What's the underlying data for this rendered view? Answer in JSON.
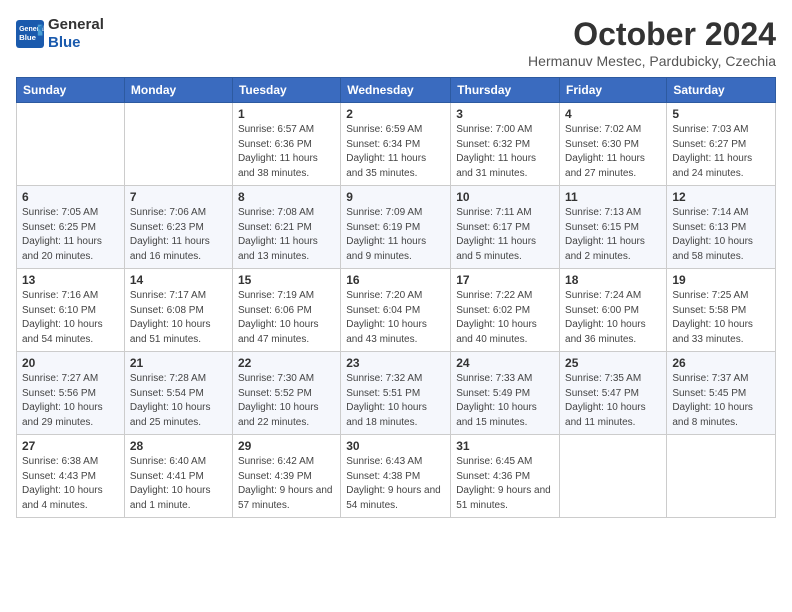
{
  "header": {
    "logo_line1": "General",
    "logo_line2": "Blue",
    "month": "October 2024",
    "location": "Hermanuv Mestec, Pardubicky, Czechia"
  },
  "weekdays": [
    "Sunday",
    "Monday",
    "Tuesday",
    "Wednesday",
    "Thursday",
    "Friday",
    "Saturday"
  ],
  "weeks": [
    [
      {
        "day": "",
        "info": ""
      },
      {
        "day": "",
        "info": ""
      },
      {
        "day": "1",
        "info": "Sunrise: 6:57 AM\nSunset: 6:36 PM\nDaylight: 11 hours and 38 minutes."
      },
      {
        "day": "2",
        "info": "Sunrise: 6:59 AM\nSunset: 6:34 PM\nDaylight: 11 hours and 35 minutes."
      },
      {
        "day": "3",
        "info": "Sunrise: 7:00 AM\nSunset: 6:32 PM\nDaylight: 11 hours and 31 minutes."
      },
      {
        "day": "4",
        "info": "Sunrise: 7:02 AM\nSunset: 6:30 PM\nDaylight: 11 hours and 27 minutes."
      },
      {
        "day": "5",
        "info": "Sunrise: 7:03 AM\nSunset: 6:27 PM\nDaylight: 11 hours and 24 minutes."
      }
    ],
    [
      {
        "day": "6",
        "info": "Sunrise: 7:05 AM\nSunset: 6:25 PM\nDaylight: 11 hours and 20 minutes."
      },
      {
        "day": "7",
        "info": "Sunrise: 7:06 AM\nSunset: 6:23 PM\nDaylight: 11 hours and 16 minutes."
      },
      {
        "day": "8",
        "info": "Sunrise: 7:08 AM\nSunset: 6:21 PM\nDaylight: 11 hours and 13 minutes."
      },
      {
        "day": "9",
        "info": "Sunrise: 7:09 AM\nSunset: 6:19 PM\nDaylight: 11 hours and 9 minutes."
      },
      {
        "day": "10",
        "info": "Sunrise: 7:11 AM\nSunset: 6:17 PM\nDaylight: 11 hours and 5 minutes."
      },
      {
        "day": "11",
        "info": "Sunrise: 7:13 AM\nSunset: 6:15 PM\nDaylight: 11 hours and 2 minutes."
      },
      {
        "day": "12",
        "info": "Sunrise: 7:14 AM\nSunset: 6:13 PM\nDaylight: 10 hours and 58 minutes."
      }
    ],
    [
      {
        "day": "13",
        "info": "Sunrise: 7:16 AM\nSunset: 6:10 PM\nDaylight: 10 hours and 54 minutes."
      },
      {
        "day": "14",
        "info": "Sunrise: 7:17 AM\nSunset: 6:08 PM\nDaylight: 10 hours and 51 minutes."
      },
      {
        "day": "15",
        "info": "Sunrise: 7:19 AM\nSunset: 6:06 PM\nDaylight: 10 hours and 47 minutes."
      },
      {
        "day": "16",
        "info": "Sunrise: 7:20 AM\nSunset: 6:04 PM\nDaylight: 10 hours and 43 minutes."
      },
      {
        "day": "17",
        "info": "Sunrise: 7:22 AM\nSunset: 6:02 PM\nDaylight: 10 hours and 40 minutes."
      },
      {
        "day": "18",
        "info": "Sunrise: 7:24 AM\nSunset: 6:00 PM\nDaylight: 10 hours and 36 minutes."
      },
      {
        "day": "19",
        "info": "Sunrise: 7:25 AM\nSunset: 5:58 PM\nDaylight: 10 hours and 33 minutes."
      }
    ],
    [
      {
        "day": "20",
        "info": "Sunrise: 7:27 AM\nSunset: 5:56 PM\nDaylight: 10 hours and 29 minutes."
      },
      {
        "day": "21",
        "info": "Sunrise: 7:28 AM\nSunset: 5:54 PM\nDaylight: 10 hours and 25 minutes."
      },
      {
        "day": "22",
        "info": "Sunrise: 7:30 AM\nSunset: 5:52 PM\nDaylight: 10 hours and 22 minutes."
      },
      {
        "day": "23",
        "info": "Sunrise: 7:32 AM\nSunset: 5:51 PM\nDaylight: 10 hours and 18 minutes."
      },
      {
        "day": "24",
        "info": "Sunrise: 7:33 AM\nSunset: 5:49 PM\nDaylight: 10 hours and 15 minutes."
      },
      {
        "day": "25",
        "info": "Sunrise: 7:35 AM\nSunset: 5:47 PM\nDaylight: 10 hours and 11 minutes."
      },
      {
        "day": "26",
        "info": "Sunrise: 7:37 AM\nSunset: 5:45 PM\nDaylight: 10 hours and 8 minutes."
      }
    ],
    [
      {
        "day": "27",
        "info": "Sunrise: 6:38 AM\nSunset: 4:43 PM\nDaylight: 10 hours and 4 minutes."
      },
      {
        "day": "28",
        "info": "Sunrise: 6:40 AM\nSunset: 4:41 PM\nDaylight: 10 hours and 1 minute."
      },
      {
        "day": "29",
        "info": "Sunrise: 6:42 AM\nSunset: 4:39 PM\nDaylight: 9 hours and 57 minutes."
      },
      {
        "day": "30",
        "info": "Sunrise: 6:43 AM\nSunset: 4:38 PM\nDaylight: 9 hours and 54 minutes."
      },
      {
        "day": "31",
        "info": "Sunrise: 6:45 AM\nSunset: 4:36 PM\nDaylight: 9 hours and 51 minutes."
      },
      {
        "day": "",
        "info": ""
      },
      {
        "day": "",
        "info": ""
      }
    ]
  ]
}
